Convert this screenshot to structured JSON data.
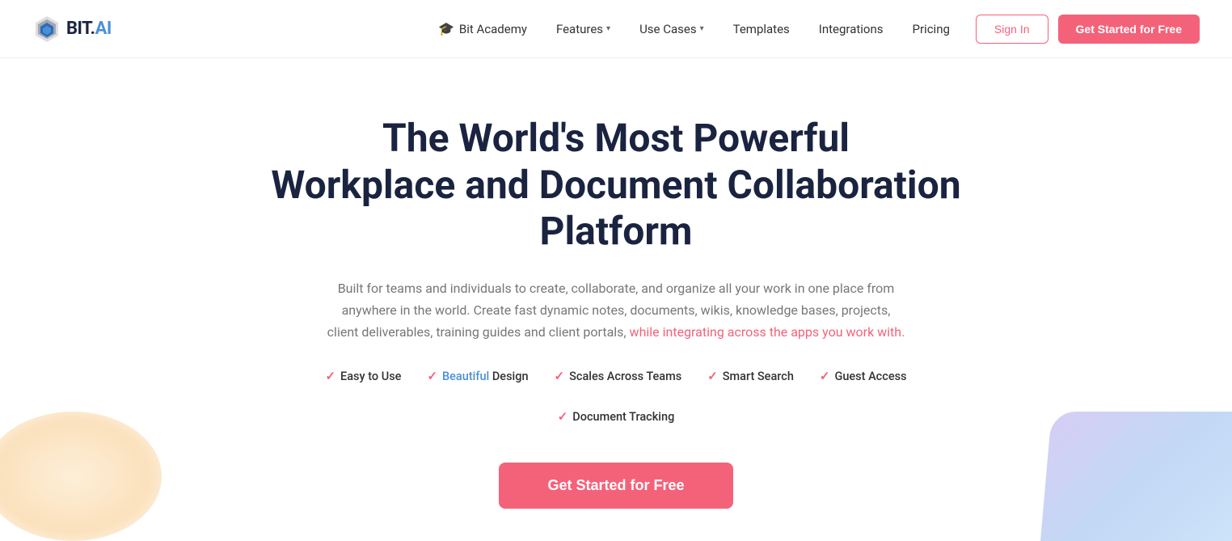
{
  "logo": {
    "text_bit": "BIT",
    "text_dot": ".",
    "text_ai": "AI"
  },
  "nav": {
    "bit_academy_label": "Bit Academy",
    "features_label": "Features",
    "use_cases_label": "Use Cases",
    "templates_label": "Templates",
    "integrations_label": "Integrations",
    "pricing_label": "Pricing",
    "signin_label": "Sign In",
    "get_started_label": "Get Started for Free"
  },
  "hero": {
    "title_line1": "The World's Most Powerful",
    "title_line2": "Workplace and Document Collaboration Platform",
    "subtitle": "Built for teams and individuals to create, collaborate, and organize all your work in one place from anywhere in the world. Create fast dynamic notes, documents, wikis, knowledge bases, projects, client deliverables, training guides and client portals, while integrating across the apps you work with.",
    "subtitle_highlight": "while integrating across the apps you work with.",
    "cta_label": "Get Started for Free",
    "features": [
      {
        "id": "easy-to-use",
        "label": "Easy to Use"
      },
      {
        "id": "beautiful-design",
        "label": "Beautiful Design",
        "highlight": "Beautiful"
      },
      {
        "id": "scales-across-teams",
        "label": "Scales Across Teams"
      },
      {
        "id": "smart-search",
        "label": "Smart Search"
      },
      {
        "id": "guest-access",
        "label": "Guest Access"
      },
      {
        "id": "document-tracking",
        "label": "Document Tracking"
      }
    ]
  },
  "colors": {
    "accent": "#f4627a",
    "blue": "#4a90d9",
    "dark": "#1a2340",
    "muted": "#777"
  }
}
